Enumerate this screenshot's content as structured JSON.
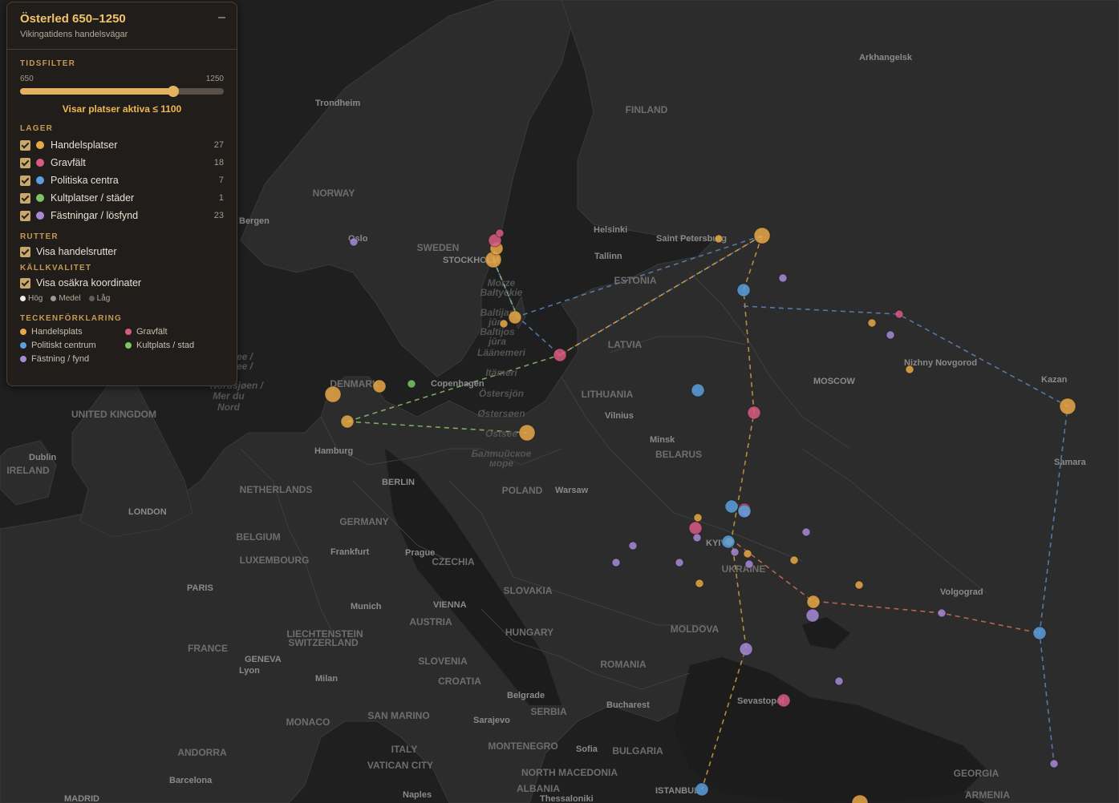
{
  "panel": {
    "title": "Österled 650–1250",
    "subtitle": "Vikingatidens handelsvägar",
    "minimize_label": "–",
    "time_filter": {
      "heading": "TIDSFILTER",
      "min_label": "650",
      "max_label": "1250",
      "value_fraction": 0.75,
      "status": "Visar platser aktiva ≤ 1100"
    },
    "layers": {
      "heading": "LAGER",
      "items": [
        {
          "label": "Handelsplatser",
          "count": "27",
          "color": "#e8a848"
        },
        {
          "label": "Gravfält",
          "count": "18",
          "color": "#d85c82"
        },
        {
          "label": "Politiska centra",
          "count": "7",
          "color": "#5b9fdc"
        },
        {
          "label": "Kultplatser / städer",
          "count": "1",
          "color": "#7cc466"
        },
        {
          "label": "Fästningar / lösfynd",
          "count": "23",
          "color": "#a78ad6"
        }
      ]
    },
    "routes": {
      "heading": "RUTTER",
      "toggle_label": "Visa handelsrutter"
    },
    "source_quality": {
      "heading": "KÄLLKVALITET",
      "toggle_label": "Visa osäkra koordinater",
      "levels": [
        {
          "label": "Hög",
          "color": "#eeeeee"
        },
        {
          "label": "Medel",
          "color": "#9a9a9a"
        },
        {
          "label": "Låg",
          "color": "#5e5e5e"
        }
      ]
    },
    "legend": {
      "heading": "TECKENFÖRKLARING",
      "items": [
        {
          "label": "Handelsplats",
          "color": "#e8a848"
        },
        {
          "label": "Gravfält",
          "color": "#d85c82"
        },
        {
          "label": "Politiskt centrum",
          "color": "#5b9fdc"
        },
        {
          "label": "Kultplats / stad",
          "color": "#7cc466"
        },
        {
          "label": "Fästning / fynd",
          "color": "#a78ad6"
        }
      ]
    }
  },
  "map": {
    "sea_labels": [
      "Morze",
      "Bałtyckie",
      "Baltijas",
      "jūra",
      "Baltijos",
      "jūra",
      "Läänemeri",
      "Itämeri",
      "Östersjön",
      "Østersøen",
      "Ostsee",
      "Балтийское",
      "море",
      "ee /",
      "ee /",
      "Nordsjøen /",
      "Mer du",
      "Nord"
    ],
    "country_labels": [
      "FINLAND",
      "NORWAY",
      "SWEDEN",
      "ESTONIA",
      "LATVIA",
      "LITHUANIA",
      "BELARUS",
      "DENMARK",
      "UNITED KINGDOM",
      "IRELAND",
      "NETHERLANDS",
      "BELGIUM",
      "LUXEMBOURG",
      "GERMANY",
      "POLAND",
      "CZECHIA",
      "SLOVAKIA",
      "AUSTRIA",
      "HUNGARY",
      "UKRAINE",
      "MOLDOVA",
      "ROMANIA",
      "FRANCE",
      "SWITZERLAND",
      "LIECHTENSTEIN",
      "SLOVENIA",
      "CROATIA",
      "SERBIA",
      "SAN MARINO",
      "MONACO",
      "ANDORRA",
      "ITALY",
      "VATICAN CITY",
      "MONTENEGRO",
      "NORTH MACEDONIA",
      "ALBANIA",
      "BULGARIA",
      "GEORGIA",
      "ARMENIA"
    ],
    "city_labels": [
      "Arkhangelsk",
      "Trondheim",
      "Bergen",
      "Oslo",
      "STOCKHOLM",
      "Helsinki",
      "Saint Petersburg",
      "Tallinn",
      "Copenhagen",
      "Vilnius",
      "Minsk",
      "MOSCOW",
      "Nizhny Novgorod",
      "Kazan",
      "Samara",
      "Hamburg",
      "BERLIN",
      "Warsaw",
      "Dublin",
      "LONDON",
      "Frankfurt",
      "Prague",
      "PARIS",
      "Munich",
      "VIENNA",
      "GENEVA",
      "Lyon",
      "Milan",
      "Belgrade",
      "Bucharest",
      "Sarajevo",
      "Sofia",
      "KYIV",
      "Volgograd",
      "Sevastopol",
      "ISTANBUL",
      "Barcelona",
      "Naples",
      "Thessaloniki",
      "MADRID"
    ]
  },
  "sites": [
    {
      "kind": "trade",
      "size": "large"
    },
    {
      "kind": "trade",
      "size": "large"
    },
    {
      "kind": "trade",
      "size": "medium"
    },
    {
      "kind": "trade",
      "size": "medium"
    },
    {
      "kind": "trade",
      "size": "medium"
    },
    {
      "kind": "trade",
      "size": "large"
    },
    {
      "kind": "trade",
      "size": "large"
    },
    {
      "kind": "trade",
      "size": "large"
    },
    {
      "kind": "trade",
      "size": "medium"
    },
    {
      "kind": "trade",
      "size": "small"
    },
    {
      "kind": "trade",
      "size": "small"
    },
    {
      "kind": "trade",
      "size": "small"
    },
    {
      "kind": "trade",
      "size": "small"
    },
    {
      "kind": "trade",
      "size": "small"
    },
    {
      "kind": "trade",
      "size": "small"
    },
    {
      "kind": "trade",
      "size": "small"
    },
    {
      "kind": "trade",
      "size": "small"
    },
    {
      "kind": "trade",
      "size": "small"
    },
    {
      "kind": "trade",
      "size": "medium"
    },
    {
      "kind": "trade",
      "size": "small"
    },
    {
      "kind": "trade",
      "size": "large"
    },
    {
      "kind": "grave",
      "size": "medium"
    },
    {
      "kind": "grave",
      "size": "small"
    },
    {
      "kind": "grave",
      "size": "medium"
    },
    {
      "kind": "grave",
      "size": "medium"
    },
    {
      "kind": "grave",
      "size": "small"
    },
    {
      "kind": "grave",
      "size": "medium"
    },
    {
      "kind": "grave",
      "size": "medium"
    },
    {
      "kind": "grave",
      "size": "medium"
    },
    {
      "kind": "grave",
      "size": "small"
    },
    {
      "kind": "political",
      "size": "medium"
    },
    {
      "kind": "political",
      "size": "medium"
    },
    {
      "kind": "political",
      "size": "medium"
    },
    {
      "kind": "political",
      "size": "medium"
    },
    {
      "kind": "political",
      "size": "medium"
    },
    {
      "kind": "political",
      "size": "medium"
    },
    {
      "kind": "political",
      "size": "medium"
    },
    {
      "kind": "cult",
      "size": "small"
    },
    {
      "kind": "fort",
      "size": "small"
    },
    {
      "kind": "fort",
      "size": "small"
    },
    {
      "kind": "fort",
      "size": "small"
    },
    {
      "kind": "fort",
      "size": "small"
    },
    {
      "kind": "fort",
      "size": "small"
    },
    {
      "kind": "fort",
      "size": "small"
    },
    {
      "kind": "fort",
      "size": "small"
    },
    {
      "kind": "fort",
      "size": "small"
    },
    {
      "kind": "fort",
      "size": "medium"
    },
    {
      "kind": "fort",
      "size": "medium"
    },
    {
      "kind": "fort",
      "size": "small"
    },
    {
      "kind": "fort",
      "size": "small"
    },
    {
      "kind": "fort",
      "size": "small"
    },
    {
      "kind": "fort",
      "size": "small"
    },
    {
      "kind": "fort",
      "size": "small"
    }
  ],
  "route_colors": [
    "#5d87b8",
    "#c9a040",
    "#8fbf6f",
    "#d0705a",
    "#e0a040"
  ]
}
